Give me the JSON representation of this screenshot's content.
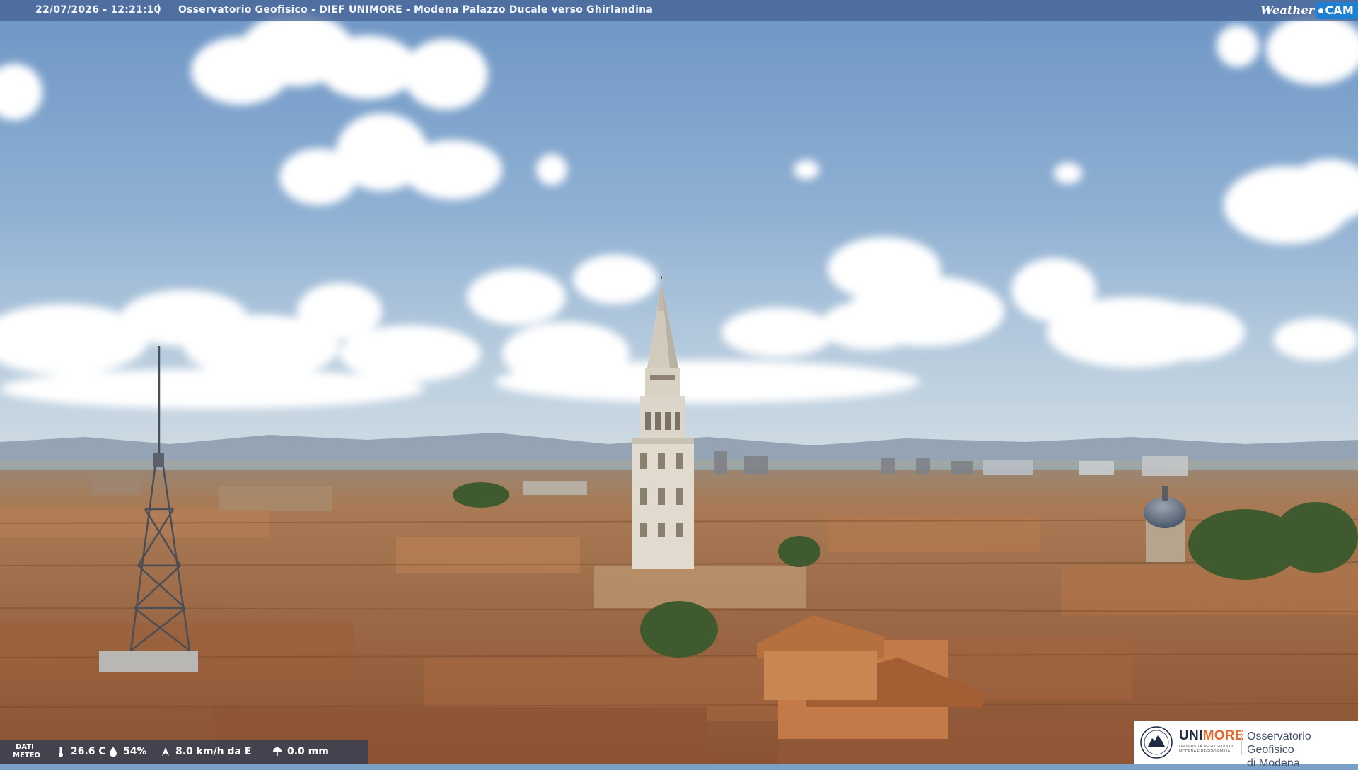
{
  "overlay": {
    "timestamp": "22/07/2026 - 12:21:10",
    "separator": "|",
    "caption": "Osservatorio Geofisico - DIEF UNIMORE - Modena Palazzo Ducale verso Ghirlandina",
    "weathercam_logo": {
      "word": "Weather",
      "cam": "CAM"
    }
  },
  "meteo": {
    "label_line1": "DATI",
    "label_line2": "METEO",
    "temperature": "26.6 C",
    "humidity": "54%",
    "wind": "8.0 km/h da E",
    "rain": "0.0 mm",
    "icons": [
      "thermometer-icon",
      "humidity-drop-icon",
      "wind-icon",
      "rain-gauge-icon"
    ]
  },
  "unimore_logo": {
    "brand_uni": "UNI",
    "brand_more": "MORE",
    "subtitle": "Università degli Studi di Modena e Reggio Emilia",
    "institution_line1": "Osservatorio Geofisico",
    "institution_line2": "di Modena"
  },
  "colors": {
    "sky_top": "#6d95c4",
    "sky_horizon": "#c8d6e2",
    "roof": "#b9774a",
    "tower": "#d9d2c4",
    "accent_more": "#e2692b",
    "weathercam_blue": "#1f7fd0"
  }
}
